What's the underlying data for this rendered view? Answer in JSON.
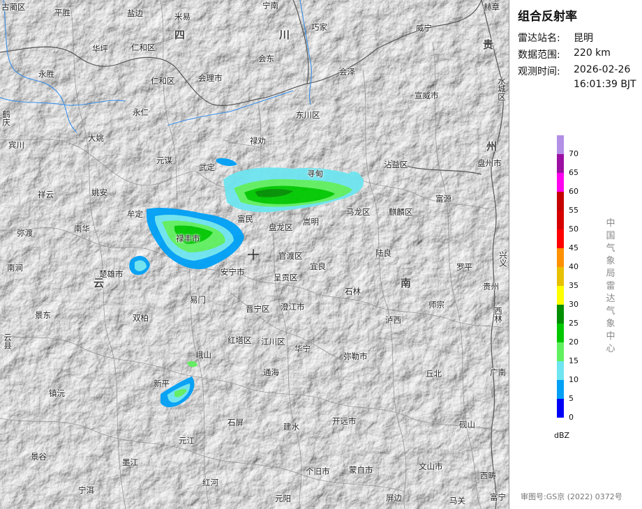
{
  "panel": {
    "title": "组合反射率",
    "station_label": "雷达站名:",
    "station_value": "昆明",
    "range_label": "数据范围:",
    "range_value": "220 km",
    "time_label": "观测时间:",
    "time_date": "2026-02-26",
    "time_clock": "16:01:39 BJT",
    "organization": "中国气象局雷达气象中心",
    "review_number": "审图号:GS京 (2022) 0372号"
  },
  "legend": {
    "unit": "dBZ",
    "levels": [
      {
        "value": "70",
        "color": "#b38fe6"
      },
      {
        "value": "65",
        "color": "#9c0fa3"
      },
      {
        "value": "60",
        "color": "#ff00f0"
      },
      {
        "value": "55",
        "color": "#c40000"
      },
      {
        "value": "50",
        "color": "#d60000"
      },
      {
        "value": "45",
        "color": "#ff0000"
      },
      {
        "value": "40",
        "color": "#ff9000"
      },
      {
        "value": "35",
        "color": "#e7c000"
      },
      {
        "value": "30",
        "color": "#ffff00"
      },
      {
        "value": "25",
        "color": "#008f00"
      },
      {
        "value": "20",
        "color": "#00c800"
      },
      {
        "value": "15",
        "color": "#60f060"
      },
      {
        "value": "10",
        "color": "#6ee5f0"
      },
      {
        "value": "5",
        "color": "#00a0f6"
      },
      {
        "value": "0",
        "color": "#0000f6"
      }
    ]
  },
  "map": {
    "places": {
      "gulinqu": "古蔺区",
      "pingshan": "平胜",
      "yanbian": "盐边",
      "miyi": "米易",
      "ningnan": "宁南",
      "hezhang": "赫章",
      "sichuan1": "四",
      "sichuan2": "川",
      "qiaojia": "巧家",
      "weining": "威宁",
      "huaping": "华坪",
      "renhequ": "仁和区",
      "huidong": "会东",
      "weixin": "钟",
      "guizhou1": "贵",
      "yongsheng": "永胜",
      "renhequ2": "仁和区",
      "huili": "会理市",
      "huize": "会泽",
      "xuanwei": "宣威市",
      "shuicheng": "水城区",
      "heqing": "鹤庆",
      "yongren": "永仁",
      "dongchuan": "东川区",
      "binchuan": "宾川",
      "dayao": "大姚",
      "luquan": "禄劝",
      "zhanyi": "沾益区",
      "pan": "盘州市",
      "xiangyun": "祥云",
      "yuanmou": "元谋",
      "wuding": "武定",
      "xundian": "寻甸",
      "fuyuan": "富源",
      "guizhou2": "州",
      "yaoan": "姚安",
      "midu": "弥渡",
      "mouding": "牟定",
      "nanhua": "南华",
      "fumin": "富民",
      "panlong": "盘龙区",
      "songming": "嵩明",
      "malong": "马龙区",
      "qilin": "麒麟区",
      "luliang": "陆良",
      "lufeng": "禄丰市",
      "nanjian": "南涧",
      "chuxiong": "楚雄市",
      "guandu": "官渡区",
      "yiliang": "宜良",
      "anning": "安宁市",
      "chenggong": "呈贡区",
      "luoping": "罗平",
      "yunnan1": "云",
      "yunnan2": "南",
      "xingyi": "兴义",
      "guizhou3": "贵州",
      "shilin": "石林",
      "yimen": "易门",
      "jinning": "晋宁区",
      "chengjiang": "澄江市",
      "shizong": "师宗",
      "jingdong": "景东",
      "shuangbai": "双柏",
      "xilin": "西林",
      "luxi": "泸西",
      "hongta": "红塔区",
      "jiangchuan": "江川区",
      "huaning": "华宁",
      "emei": "峨山",
      "mile": "弥勒市",
      "yunxian": "云县",
      "tonghai": "通海",
      "qiubei": "丘北",
      "guangnan": "广南",
      "xinping": "新平",
      "zhenyuan": "镇沅",
      "shiping": "石屏",
      "jianshui": "建水",
      "kaiyuan": "开远市",
      "yanshan": "砚山",
      "yuanjiang": "元江",
      "jinggu": "景谷",
      "mojiang": "墨江",
      "gejiu": "个旧市",
      "mengzi": "蒙自市",
      "wenshan": "文山市",
      "ningear": "宁洱",
      "honghe": "红河",
      "xichou": "西畴",
      "yuanyang": "元阳",
      "pingbian": "屏边",
      "malipo": "马关",
      "funing": "富宁"
    }
  }
}
